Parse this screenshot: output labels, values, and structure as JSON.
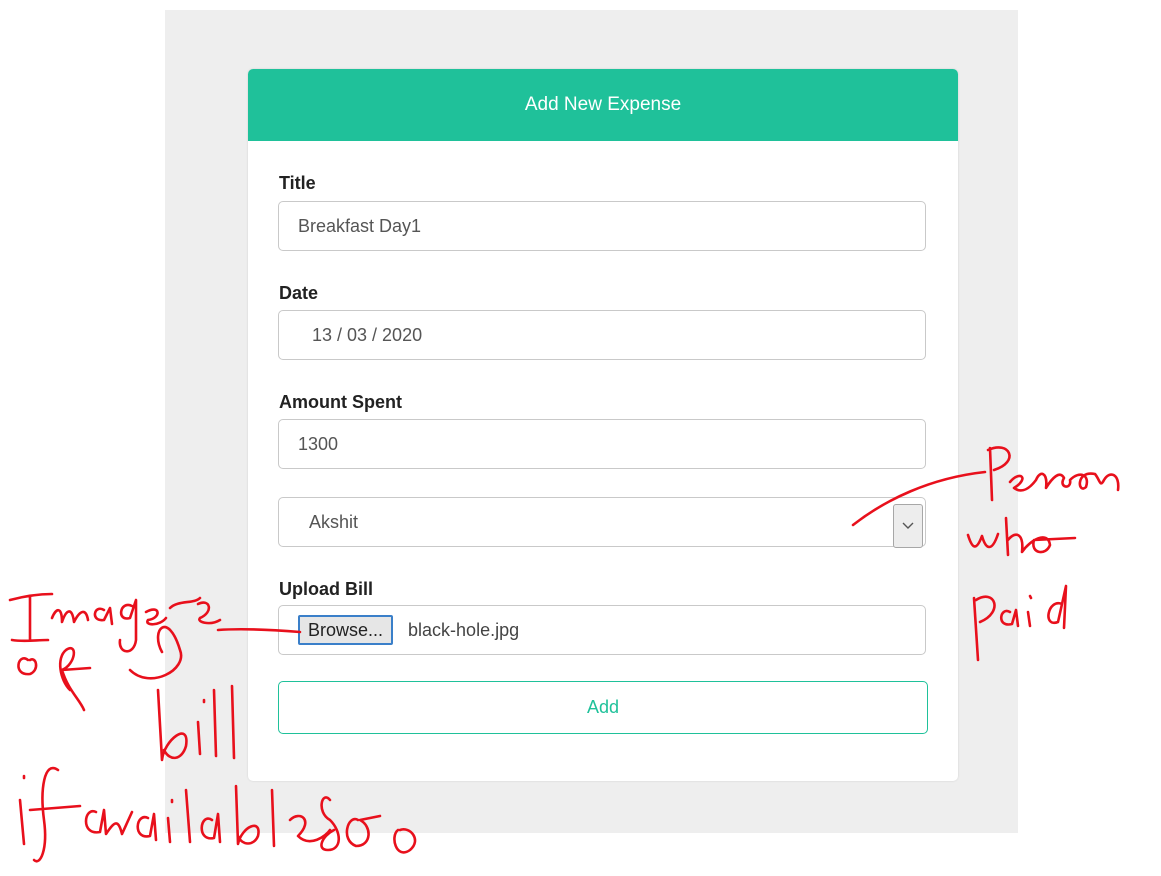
{
  "form": {
    "header": "Add New Expense",
    "title_label": "Title",
    "title_value": "Breakfast Day1",
    "date_label": "Date",
    "date_value": "13 / 03 / 2020",
    "amount_label": "Amount Spent",
    "amount_value": "1300",
    "payer_selected": "Akshit",
    "upload_label": "Upload Bill",
    "browse_label": "Browse...",
    "file_name": "black-hole.jpg",
    "submit_label": "Add"
  },
  "annotations": {
    "person_note": "Person who paid",
    "bill_note": "Image of bill if available"
  },
  "colors": {
    "accent": "#1fc19a",
    "annotation_ink": "#e8101c"
  }
}
